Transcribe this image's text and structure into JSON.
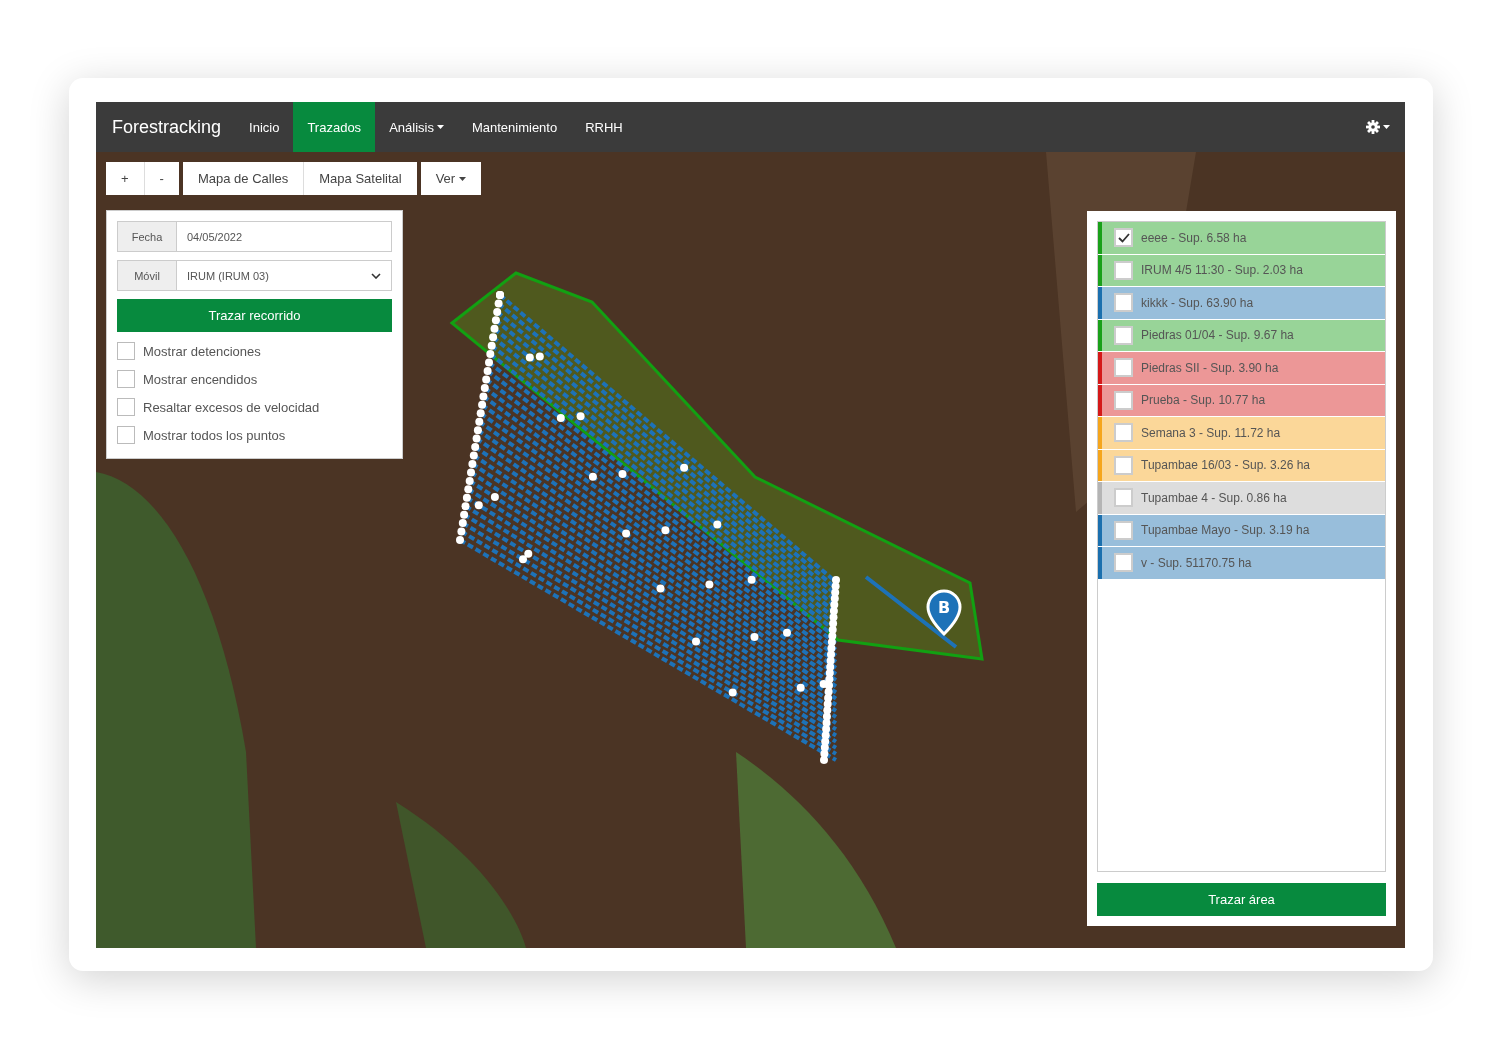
{
  "navbar": {
    "brand": "Forestracking",
    "items": [
      {
        "label": "Inicio",
        "selected": false,
        "has_menu": false
      },
      {
        "label": "Trazados",
        "selected": true,
        "has_menu": false
      },
      {
        "label": "Análisis",
        "selected": false,
        "has_menu": true
      },
      {
        "label": "Mantenimiento",
        "selected": false,
        "has_menu": false
      },
      {
        "label": "RRHH",
        "selected": false,
        "has_menu": false
      }
    ]
  },
  "map_controls": {
    "zoom": [
      "+",
      "-"
    ],
    "layers": [
      "Mapa de Calles",
      "Mapa Satelital"
    ],
    "view": "Ver"
  },
  "route_panel": {
    "date": {
      "label": "Fecha",
      "value": "04/05/2022"
    },
    "vehicle": {
      "label": "Móvil",
      "value": "IRUM (IRUM 03)"
    },
    "button": "Trazar recorrido",
    "options": [
      {
        "label": "Mostrar detenciones",
        "checked": false
      },
      {
        "label": "Mostrar encendidos",
        "checked": false
      },
      {
        "label": "Resaltar excesos de velocidad",
        "checked": false
      },
      {
        "label": "Mostrar todos los puntos",
        "checked": false
      }
    ]
  },
  "map": {
    "marker": "B"
  },
  "areas_panel": {
    "items": [
      {
        "label": "eeee - Sup. 6.58 ha",
        "checked": true,
        "color": "#19a019"
      },
      {
        "label": "IRUM 4/5 11:30 - Sup. 2.03 ha",
        "checked": false,
        "color": "#19a019"
      },
      {
        "label": "kikkk - Sup. 63.90 ha",
        "checked": false,
        "color": "#1a6fae"
      },
      {
        "label": "Piedras 01/04 - Sup. 9.67 ha",
        "checked": false,
        "color": "#19a019"
      },
      {
        "label": "Piedras SII - Sup. 3.90 ha",
        "checked": false,
        "color": "#d41818"
      },
      {
        "label": "Prueba - Sup. 10.77 ha",
        "checked": false,
        "color": "#d41818"
      },
      {
        "label": "Semana 3 - Sup. 11.72 ha",
        "checked": false,
        "color": "#f5a51c"
      },
      {
        "label": "Tupambae 16/03 - Sup. 3.26 ha",
        "checked": false,
        "color": "#f5a51c"
      },
      {
        "label": "Tupambae 4 - Sup. 0.86 ha",
        "checked": false,
        "color": "#b4b4b4"
      },
      {
        "label": "Tupambae Mayo - Sup. 3.19 ha",
        "checked": false,
        "color": "#1a6fae"
      },
      {
        "label": "v - Sup. 51170.75 ha",
        "checked": false,
        "color": "#1a6fae"
      }
    ],
    "button": "Trazar área"
  }
}
